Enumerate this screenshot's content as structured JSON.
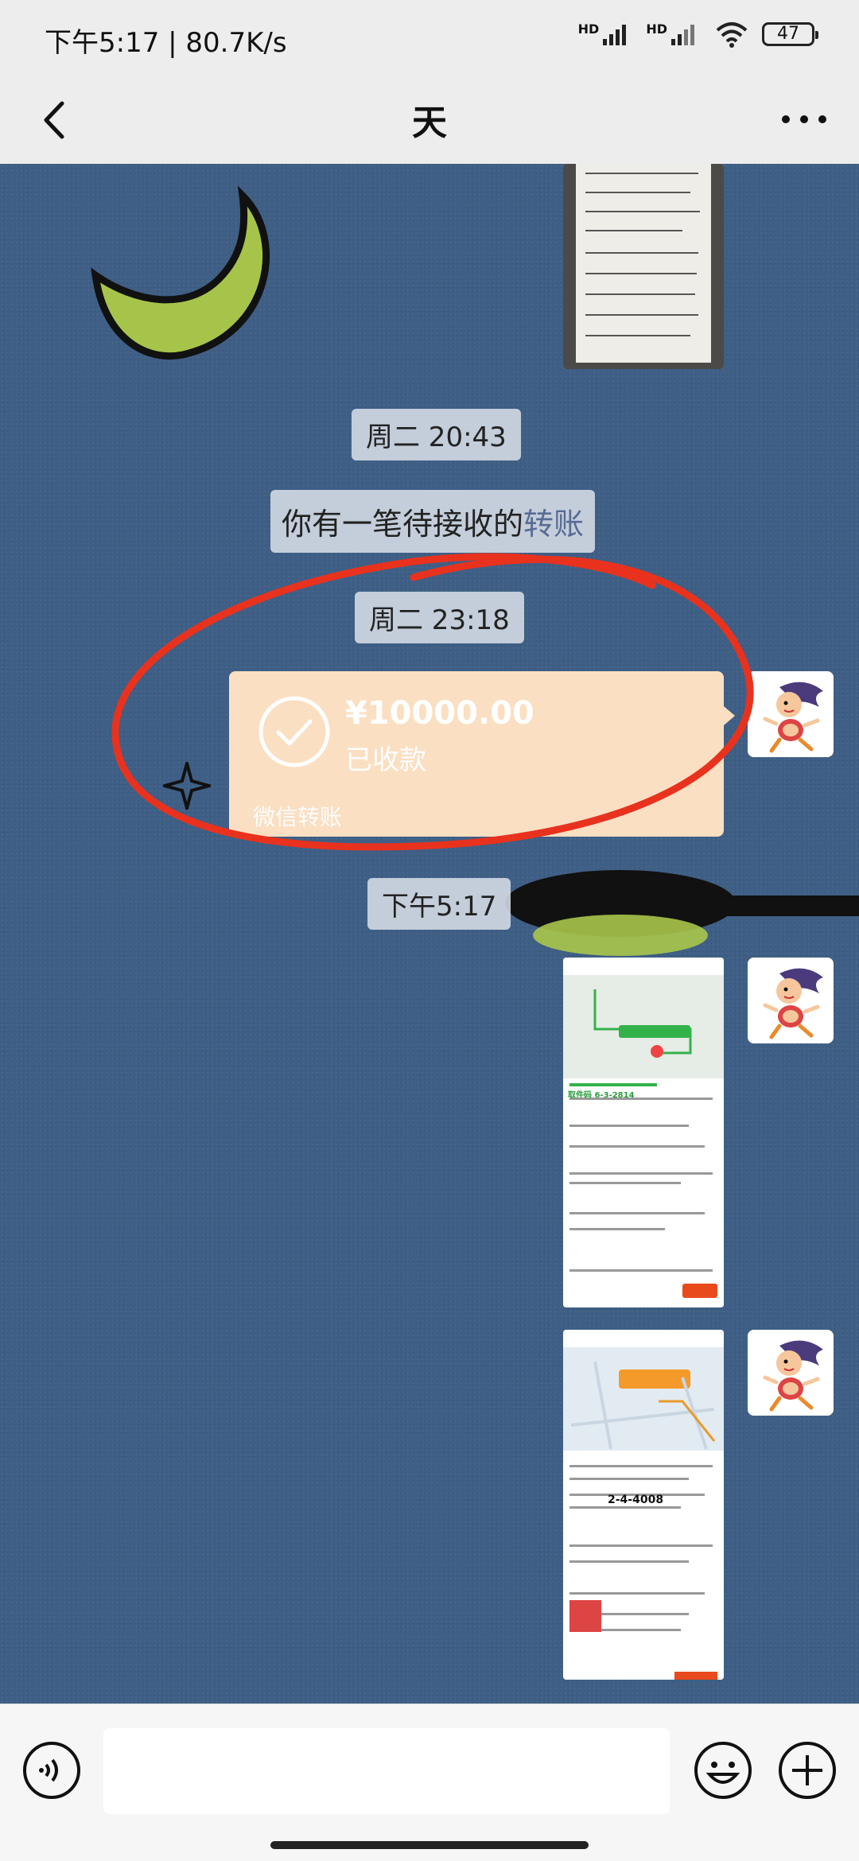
{
  "status_bar": {
    "time_speed": "下午5:17 | 80.7K/s",
    "net1": "HD",
    "net2": "HD",
    "battery": "47"
  },
  "header": {
    "title": "天"
  },
  "chat": {
    "timestamps": [
      "周二 20:43",
      "周二 23:18",
      "下午5:17"
    ],
    "notice": {
      "text": "你有一笔待接收的",
      "link": "转账"
    },
    "transfer": {
      "amount": "¥10000.00",
      "status": "已收款",
      "footer": "微信转账"
    },
    "images": [
      {
        "thumb": "receipt-note-image"
      },
      {
        "thumb": "delivery-map-screenshot-1",
        "code": "取件码 6-3-2814"
      },
      {
        "thumb": "delivery-map-screenshot-2",
        "code": "2-4-4008"
      }
    ]
  },
  "input_bar": {
    "placeholder": ""
  },
  "colors": {
    "transfer_bg": "#fbdfc2",
    "chat_bg": "#3f5f86",
    "link": "#576b95",
    "annotation_red": "#e8321e"
  }
}
